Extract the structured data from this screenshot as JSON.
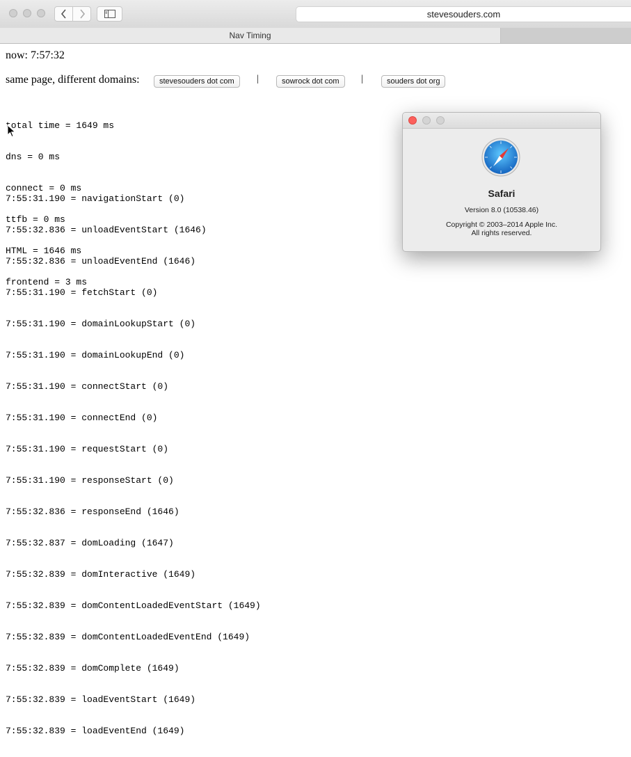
{
  "browser": {
    "address": "stevesouders.com",
    "tabs": [
      {
        "label": "Nav Timing",
        "active": true
      }
    ]
  },
  "page": {
    "now_text": "now: 7:57:32",
    "domains_label": "same page, different domains:",
    "buttons": [
      "stevesouders dot com",
      "sowrock dot com",
      "souders dot org"
    ],
    "separator": "|",
    "summary": [
      "total time = 1649 ms",
      "dns = 0 ms",
      "connect = 0 ms",
      "ttfb = 0 ms",
      "HTML = 1646 ms",
      "frontend = 3 ms"
    ],
    "events": [
      "7:55:31.190 = navigationStart (0)",
      "7:55:32.836 = unloadEventStart (1646)",
      "7:55:32.836 = unloadEventEnd (1646)",
      "7:55:31.190 = fetchStart (0)",
      "7:55:31.190 = domainLookupStart (0)",
      "7:55:31.190 = domainLookupEnd (0)",
      "7:55:31.190 = connectStart (0)",
      "7:55:31.190 = connectEnd (0)",
      "7:55:31.190 = requestStart (0)",
      "7:55:31.190 = responseStart (0)",
      "7:55:32.836 = responseEnd (1646)",
      "7:55:32.837 = domLoading (1647)",
      "7:55:32.839 = domInteractive (1649)",
      "7:55:32.839 = domContentLoadedEventStart (1649)",
      "7:55:32.839 = domContentLoadedEventEnd (1649)",
      "7:55:32.839 = domComplete (1649)",
      "7:55:32.839 = loadEventStart (1649)",
      "7:55:32.839 = loadEventEnd (1649)"
    ]
  },
  "about_dialog": {
    "app_name": "Safari",
    "version": "Version 8.0 (10538.46)",
    "copyright": "Copyright © 2003–2014 Apple Inc.",
    "rights": "All rights reserved.",
    "icon": "safari-compass-icon"
  },
  "colors": {
    "close_red": "#fc605c",
    "compass_blue": "#1e88e5"
  }
}
